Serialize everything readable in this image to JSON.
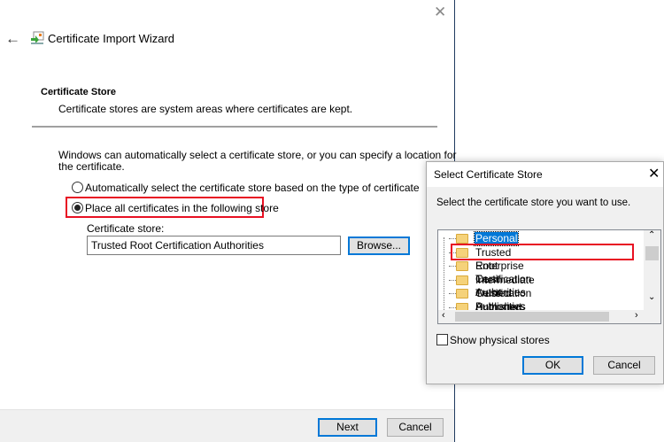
{
  "wizard": {
    "title": "Certificate Import Wizard",
    "section_title": "Certificate Store",
    "section_subtitle": "Certificate stores are system areas where certificates are kept.",
    "description_line1": "Windows can automatically select a certificate store, or you can specify a location for",
    "description_line2": "the certificate.",
    "radio_auto": "Automatically select the certificate store based on the type of certificate",
    "radio_place": "Place all certificates in the following store",
    "selected_option": "radio_place",
    "store_label": "Certificate store:",
    "store_value": "Trusted Root Certification Authorities",
    "browse_label": "Browse...",
    "next_label": "Next",
    "cancel_label": "Cancel"
  },
  "dialog": {
    "title": "Select Certificate Store",
    "instruction": "Select the certificate store you want to use.",
    "stores": [
      "Personal",
      "Trusted Root Certification Authorities",
      "Enterprise Trust",
      "Intermediate Certification Authorities",
      "Trusted Publishers",
      "Untrusted Certificates"
    ],
    "selected_store": "Personal",
    "highlighted_store": "Trusted Root Certification Authorities",
    "show_physical_label": "Show physical stores",
    "show_physical_checked": false,
    "ok_label": "OK",
    "cancel_label": "Cancel"
  },
  "colors": {
    "highlight_red": "#e81123",
    "accent_blue": "#0078d7"
  }
}
